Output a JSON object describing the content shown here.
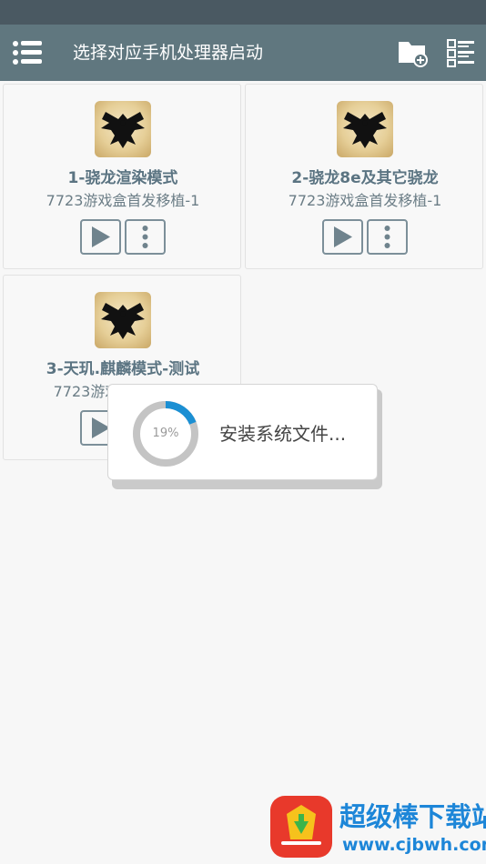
{
  "app_bar": {
    "title": "选择对应手机处理器启动",
    "menu_icon": "menu-list-icon",
    "folder_add_icon": "folder-add-icon",
    "list_view_icon": "list-view-icon",
    "background_color": "#60777f"
  },
  "cards": [
    {
      "title": "1-骁龙渲染模式",
      "subtitle": "7723游戏盒首发移植-1"
    },
    {
      "title": "2-骁龙8e及其它骁龙",
      "subtitle": "7723游戏盒首发移植-1"
    },
    {
      "title": "3-天玑.麒麟模式-测试",
      "subtitle": "7723游戏盒首发移植"
    }
  ],
  "dialog": {
    "progress_percent": 19,
    "progress_label": "19%",
    "message": "安装系统文件...",
    "accent_color": "#1b8fd3"
  },
  "watermark": {
    "name": "超级棒下载站",
    "url": "www.cjbwh.com"
  }
}
